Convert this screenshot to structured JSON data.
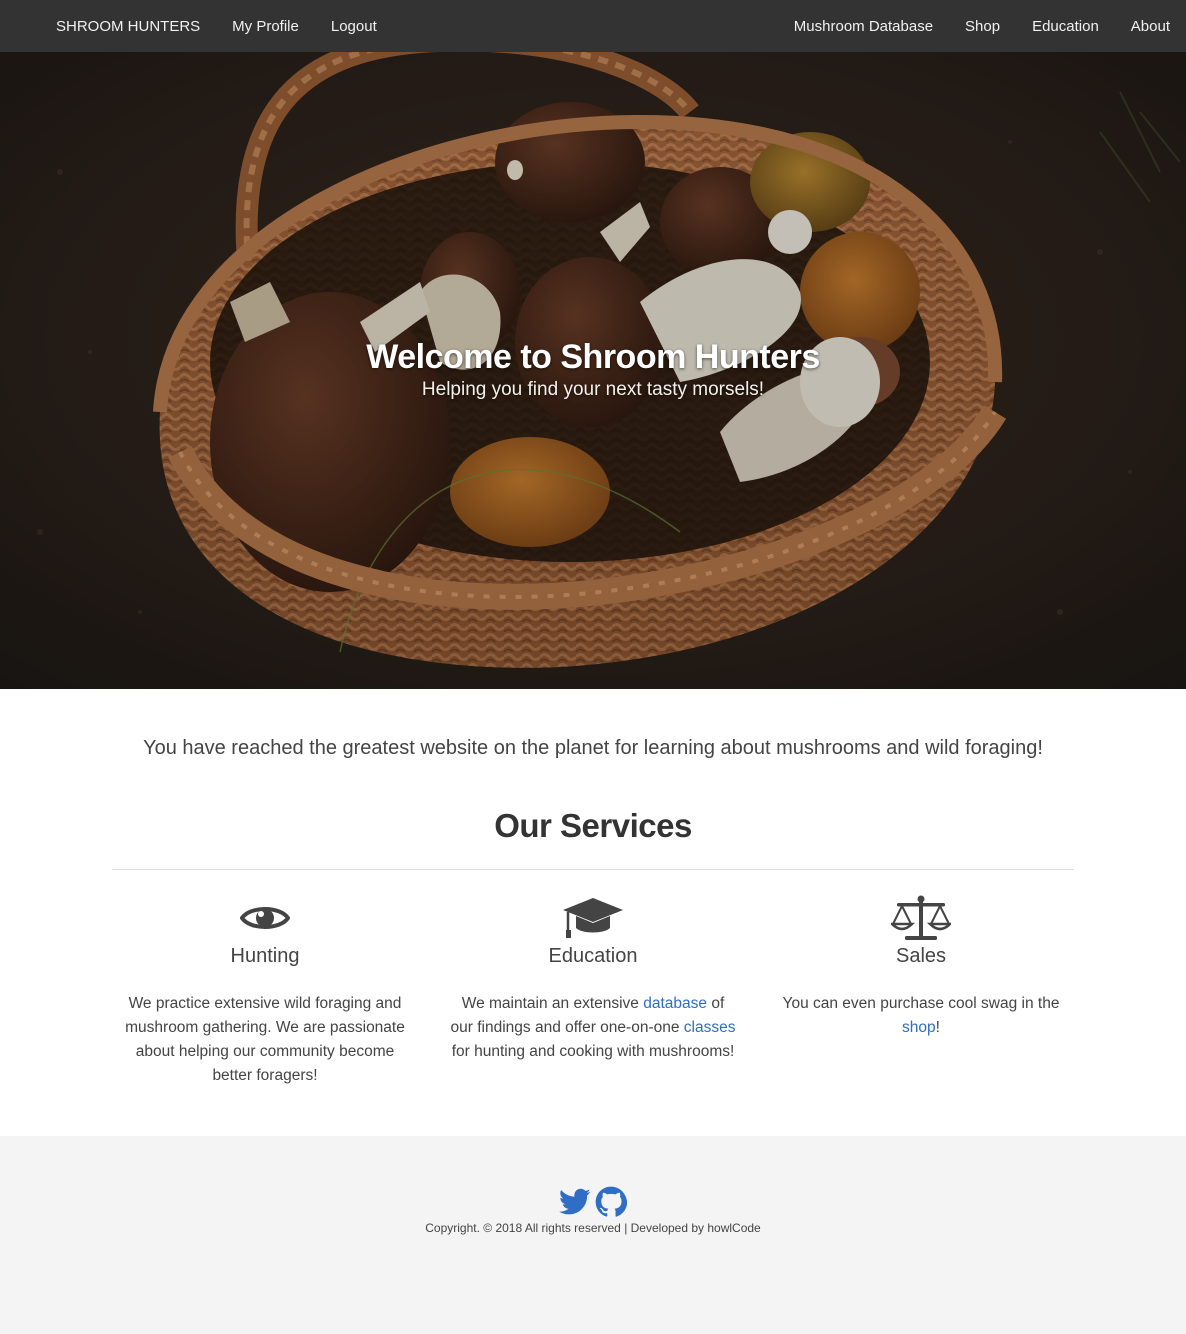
{
  "nav": {
    "brand": "SHROOM HUNTERS",
    "left_links": [
      "My Profile",
      "Logout"
    ],
    "right_links": [
      "Mushroom Database",
      "Shop",
      "Education",
      "About"
    ]
  },
  "hero": {
    "title": "Welcome to Shroom Hunters",
    "subtitle": "Helping you find your next tasty morsels!"
  },
  "main": {
    "intro": "You have reached the greatest website on the planet for learning about mushrooms and wild foraging!",
    "services_title": "Our Services",
    "services": [
      {
        "icon": "eye-icon",
        "title": "Hunting",
        "text": "We practice extensive wild foraging and mushroom gathering. We are passionate about helping our community become better foragers!"
      },
      {
        "icon": "graduation-cap-icon",
        "title": "Education",
        "text_parts": [
          "We maintain an extensive ",
          "database",
          " of our findings and offer one-on-one ",
          "classes",
          " for hunting and cooking with mushrooms!"
        ]
      },
      {
        "icon": "balance-scale-icon",
        "title": "Sales",
        "text_parts": [
          "You can even purchase cool swag in the ",
          "shop",
          "!"
        ]
      }
    ]
  },
  "footer": {
    "social_icons": [
      "twitter-icon",
      "github-icon"
    ],
    "copyright": "Copyright. © 2018 All rights reserved | Developed by howlCode"
  },
  "colors": {
    "navbar": "#333333",
    "link": "#2f6ec4",
    "footer_bg": "#f4f4f4",
    "social": "#2f6ec4"
  }
}
